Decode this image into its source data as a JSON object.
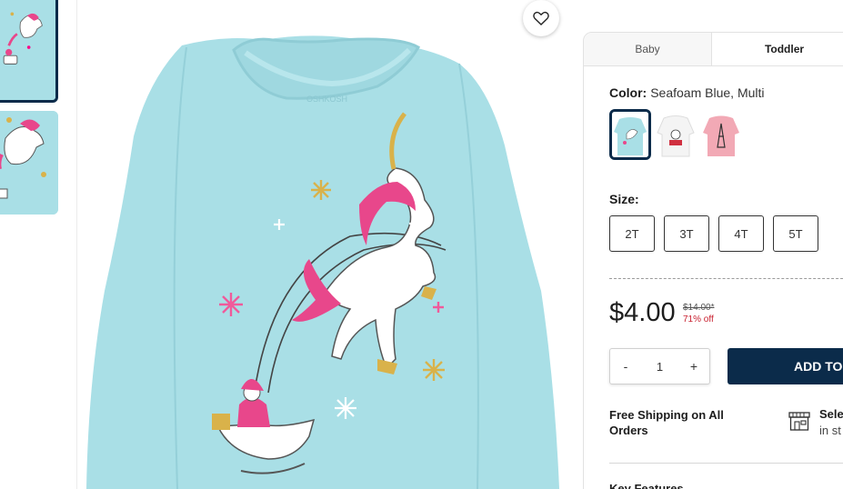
{
  "product": {
    "favorite_icon": "heart-icon",
    "tabs": [
      {
        "label": "Baby"
      },
      {
        "label": "Toddler"
      }
    ],
    "color": {
      "label": "Color:",
      "value": "Seafoam Blue, Multi",
      "swatches": [
        {
          "name": "seafoam-blue-unicorn",
          "color": "#a9dfe6"
        },
        {
          "name": "white-print",
          "color": "#f4f4f4"
        },
        {
          "name": "pink-eiffel",
          "color": "#f2a9b5"
        }
      ]
    },
    "size": {
      "label": "Size:",
      "options": [
        "2T",
        "3T",
        "4T",
        "5T"
      ]
    },
    "price": {
      "current": "$4.00",
      "original": "$14.00*",
      "discount": "71% off"
    },
    "quantity": {
      "minus": "-",
      "value": "1",
      "plus": "+"
    },
    "add_to_bag": "ADD TO",
    "shipping": "Free Shipping on All Orders",
    "store": {
      "icon": "store-icon",
      "title": "Sele",
      "subtitle": "in st"
    },
    "key_features": "Key Features"
  },
  "colors": {
    "navy": "#0b2b4a",
    "shirt": "#a9dfe6",
    "sale_red": "#c8202f"
  }
}
